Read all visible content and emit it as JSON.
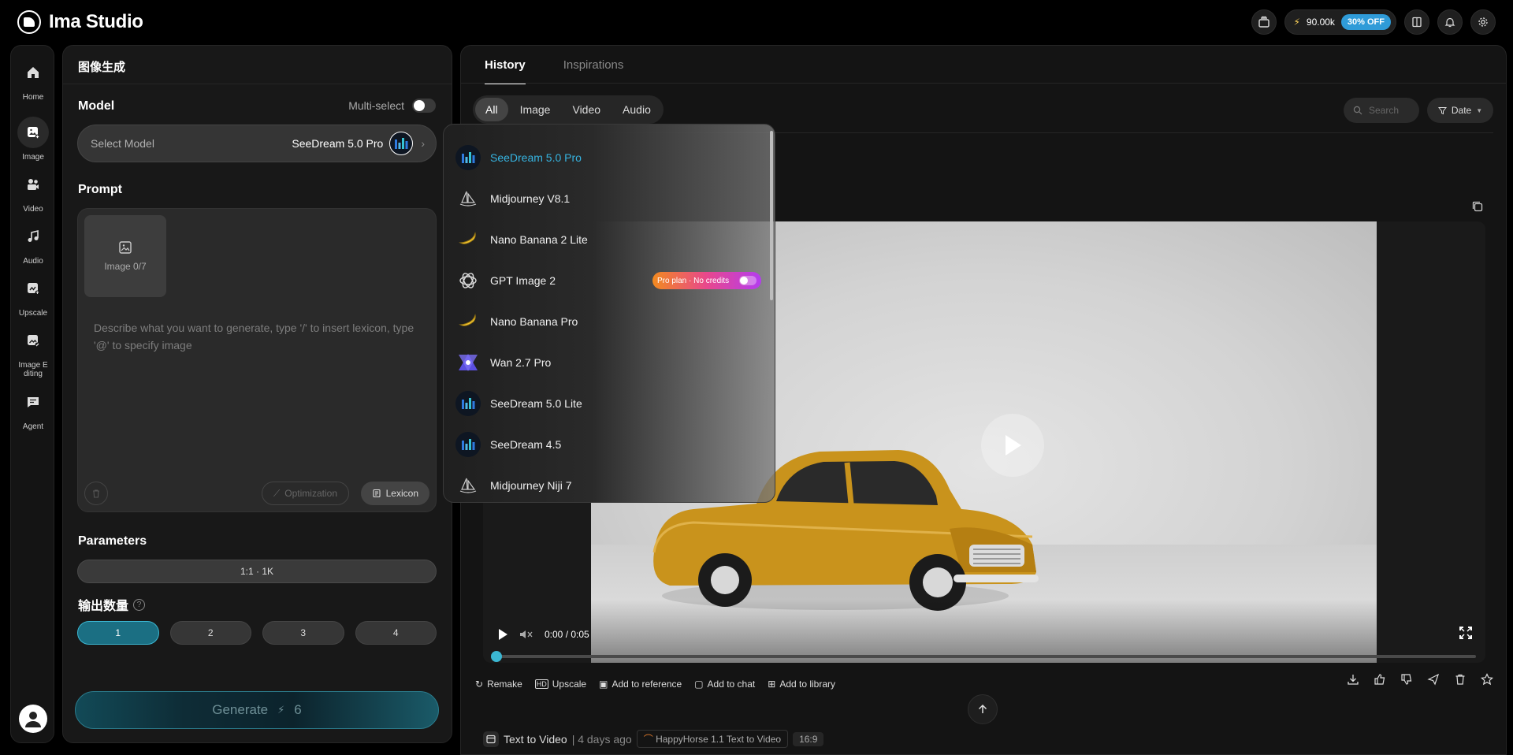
{
  "app": {
    "name": "Ima Studio"
  },
  "topbar": {
    "credits": "90.00k",
    "discount_badge": "30% OFF"
  },
  "nav": {
    "items": [
      {
        "label": "Home",
        "icon": "home-icon"
      },
      {
        "label": "Image",
        "icon": "image-icon"
      },
      {
        "label": "Video",
        "icon": "video-icon"
      },
      {
        "label": "Audio",
        "icon": "music-icon"
      },
      {
        "label": "Upscale",
        "icon": "upscale-icon"
      },
      {
        "label": "Image E diting",
        "icon": "image-edit-icon"
      },
      {
        "label": "Agent",
        "icon": "chat-icon"
      }
    ]
  },
  "panel": {
    "title": "图像生成",
    "model_label": "Model",
    "multi_select_label": "Multi-select",
    "select_model_placeholder": "Select Model",
    "selected_model": "SeeDream 5.0 Pro",
    "prompt_label": "Prompt",
    "image_slot_label": "Image 0/7",
    "prompt_placeholder": "Describe what you want to generate, type '/' to insert lexicon, type '@' to specify image",
    "optimization_label": "Optimization",
    "lexicon_label": "Lexicon",
    "parameters_label": "Parameters",
    "ratio_value": "1:1 · 1K",
    "output_count_label": "输出数量",
    "counts": [
      "1",
      "2",
      "3",
      "4"
    ],
    "selected_count": "1",
    "generate_label": "Generate",
    "generate_cost": "6"
  },
  "dropdown": {
    "models": [
      {
        "name": "SeeDream 5.0 Pro",
        "logo": "seedream-logo",
        "selected": true
      },
      {
        "name": "Midjourney V8.1",
        "logo": "midjourney-logo"
      },
      {
        "name": "Nano Banana 2 Lite",
        "logo": "banana-logo"
      },
      {
        "name": "GPT Image 2",
        "logo": "openai-logo",
        "badge": "Pro plan · No credits"
      },
      {
        "name": "Nano Banana Pro",
        "logo": "banana-logo"
      },
      {
        "name": "Wan 2.7 Pro",
        "logo": "wan-logo"
      },
      {
        "name": "SeeDream 5.0 Lite",
        "logo": "seedream-logo"
      },
      {
        "name": "SeeDream 4.5",
        "logo": "seedream-logo"
      },
      {
        "name": "Midjourney Niji 7",
        "logo": "midjourney-logo"
      }
    ]
  },
  "history": {
    "tabs": [
      "History",
      "Inspirations"
    ],
    "active_tab": "History",
    "filters": [
      "All",
      "Image",
      "Video",
      "Audio"
    ],
    "active_filter": "All",
    "search_placeholder": "Search",
    "date_label": "Date",
    "player": {
      "time": "0:00 / 0:05",
      "progress": 0
    },
    "actions": [
      "Remake",
      "Upscale",
      "Add to reference",
      "Add to chat",
      "Add to library"
    ],
    "meta": {
      "type": "Text to Video",
      "time_ago": "| 4 days ago",
      "model": "HappyHorse 1.1 Text to Video",
      "ratio": "16:9"
    }
  },
  "colors": {
    "accent": "#36b4e1",
    "selected_count_bg": "#1b6f83"
  }
}
